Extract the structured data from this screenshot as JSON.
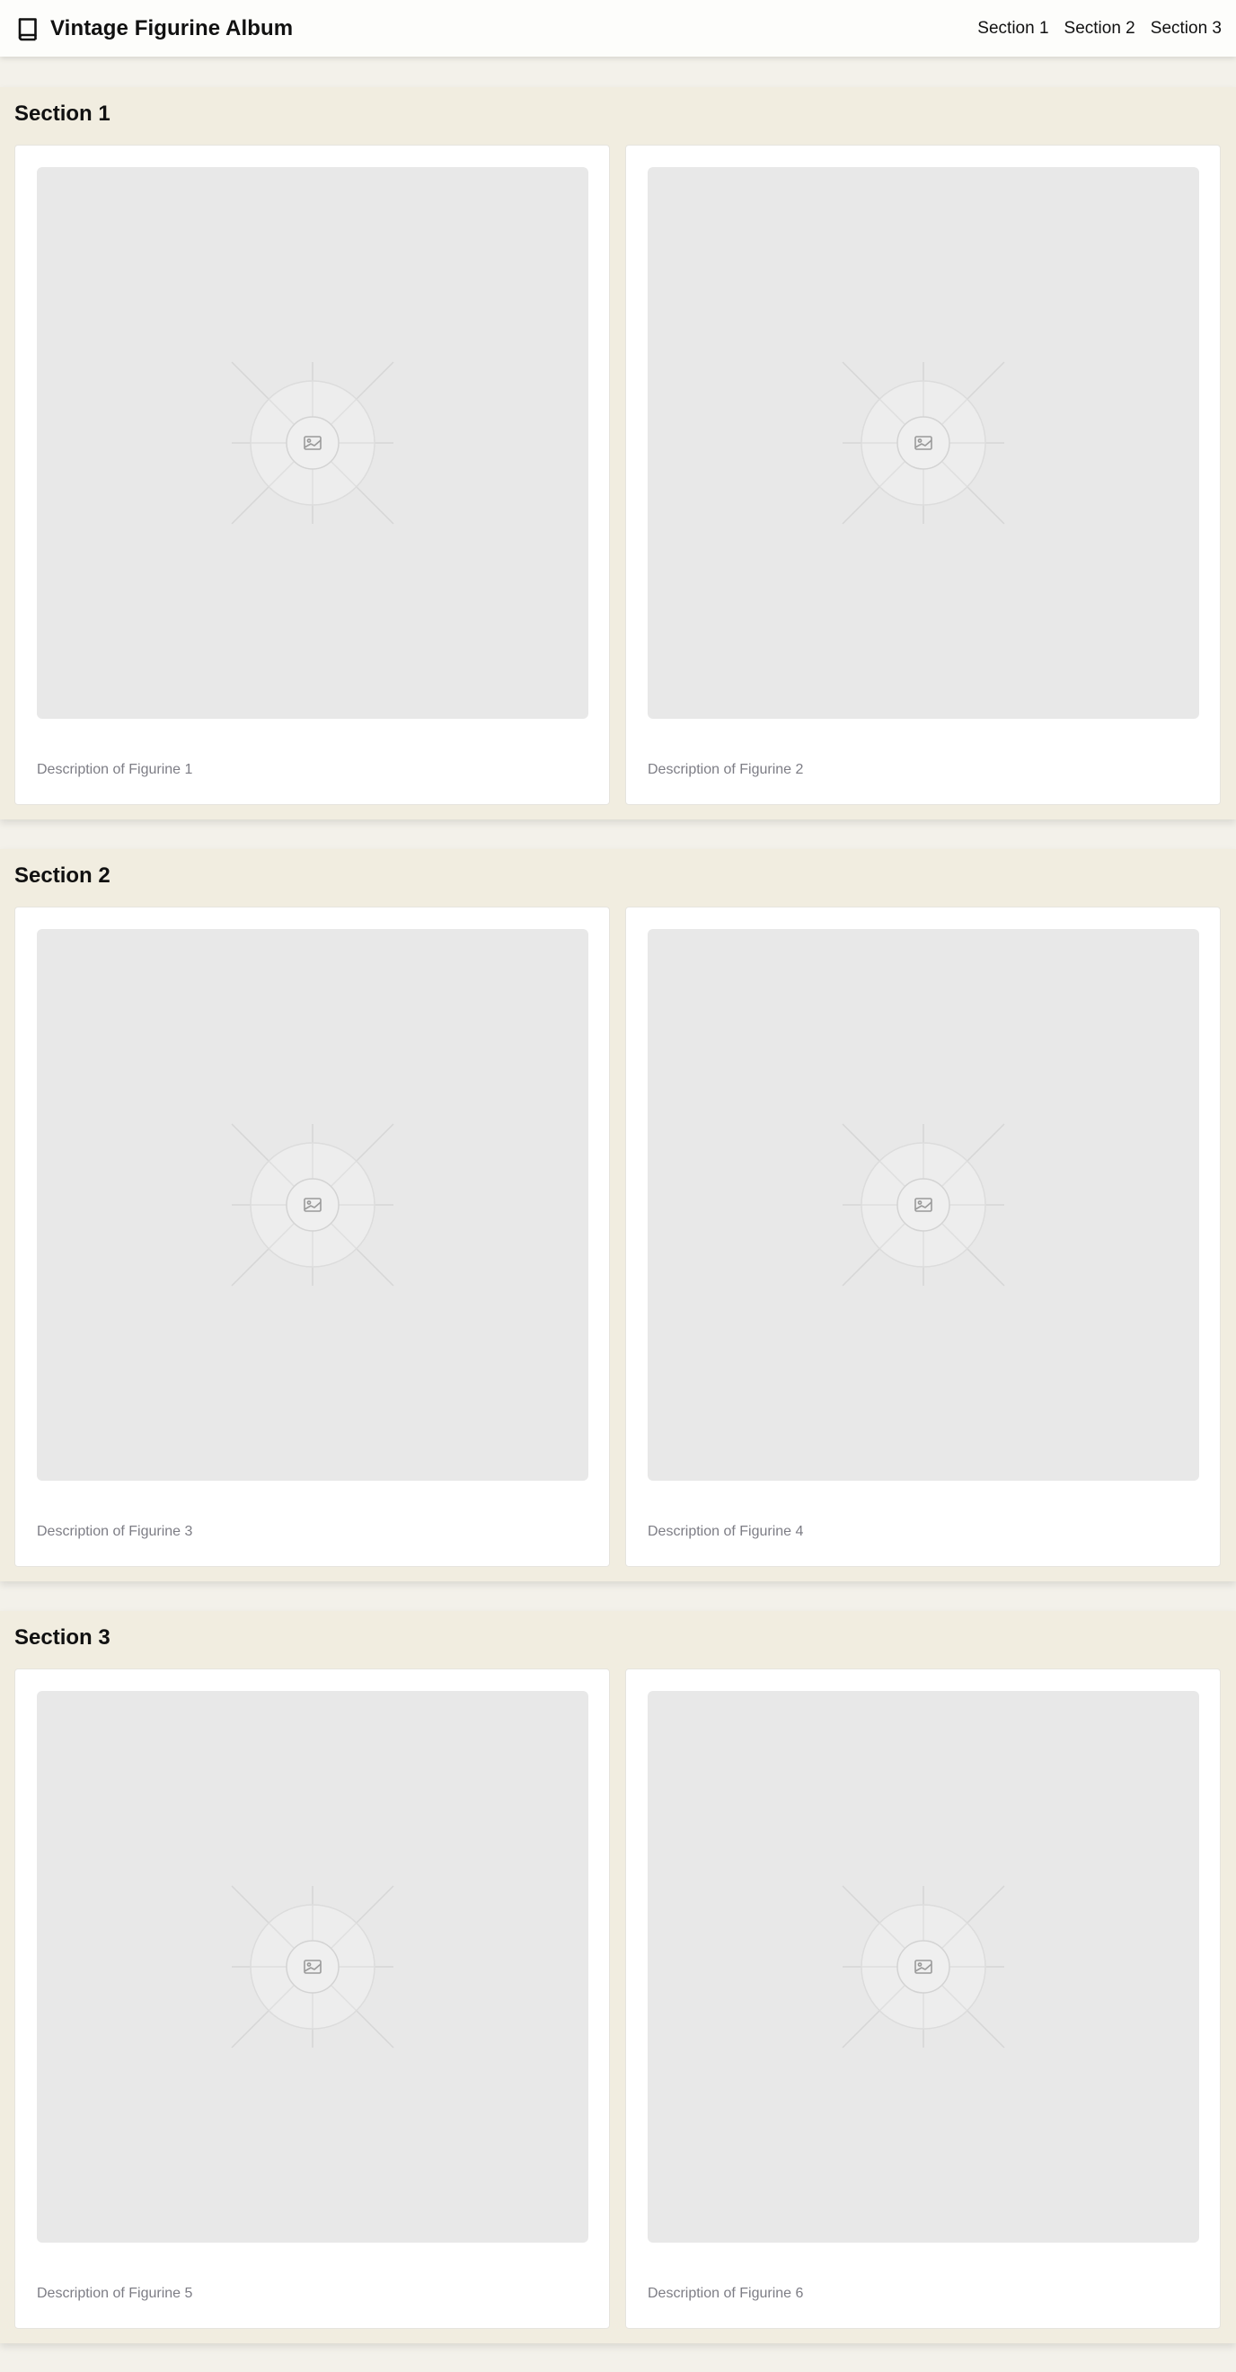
{
  "header": {
    "title": "Vintage Figurine Album",
    "icon": "book-icon",
    "nav": [
      "Section 1",
      "Section 2",
      "Section 3"
    ]
  },
  "sections": [
    {
      "title": "Section 1",
      "cards": [
        {
          "description": "Description of Figurine 1"
        },
        {
          "description": "Description of Figurine 2"
        }
      ]
    },
    {
      "title": "Section 2",
      "cards": [
        {
          "description": "Description of Figurine 3"
        },
        {
          "description": "Description of Figurine 4"
        }
      ]
    },
    {
      "title": "Section 3",
      "cards": [
        {
          "description": "Description of Figurine 5"
        },
        {
          "description": "Description of Figurine 6"
        }
      ]
    }
  ],
  "colors": {
    "page_background": "#f3f1ea",
    "section_background": "#f1ede0",
    "card_background": "#ffffff",
    "placeholder_background": "#e8e8e8",
    "description_text": "#7d7d85"
  }
}
